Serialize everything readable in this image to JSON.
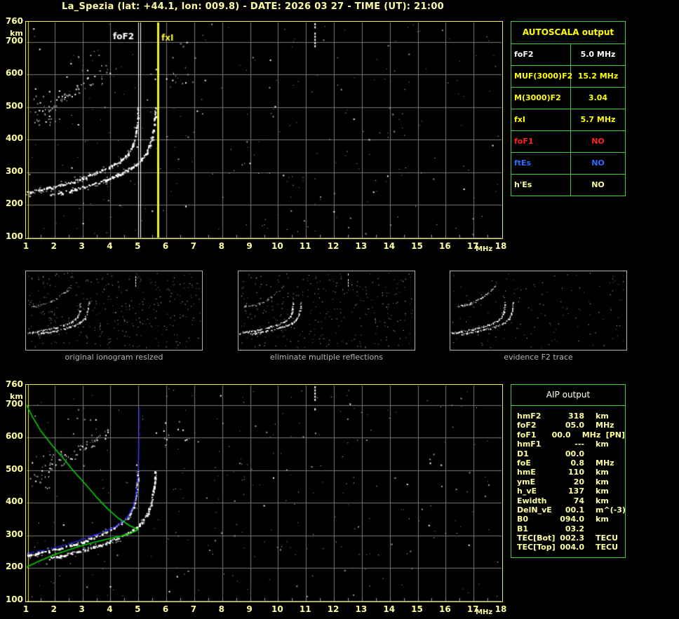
{
  "title": "La_Spezia (lat: +44.1, lon: 009.8) - DATE: 2026 03 27 - TIME (UT): 21:00",
  "colors": {
    "page_text": "#ffffa0",
    "plot_border": "#efef46",
    "grid": "#787878",
    "table_border": "#3dcd3d",
    "trace_white": "#ffffff",
    "noise_gray": "#9c9c9c",
    "profile_green": "#00d400",
    "model_blue": "#2a2aee",
    "fof2_marker": "#ffffff",
    "fxi_marker": "#f2f230",
    "caption_gray": "#b4b4b4"
  },
  "autoscala": {
    "header": "AUTOSCALA output",
    "rows": [
      {
        "param": "foF2",
        "value": "5.0 MHz",
        "color": "#ffffff"
      },
      {
        "param": "MUF(3000)F2",
        "value": "15.2 MHz",
        "color": "#ffff00"
      },
      {
        "param": "M(3000)F2",
        "value": "3.04",
        "color": "#ffff00"
      },
      {
        "param": "fxI",
        "value": "5.7 MHz",
        "color": "#ffff00"
      },
      {
        "param": "foF1",
        "value": "NO",
        "color": "#ff2020"
      },
      {
        "param": "ftEs",
        "value": "NO",
        "color": "#2e6bff"
      },
      {
        "param": "h'Es",
        "value": "NO",
        "color": "#ffffa0"
      }
    ]
  },
  "aip": {
    "header": "AIP output",
    "rows": [
      {
        "param": "hmF2",
        "value": "318",
        "unit": "km",
        "note": ""
      },
      {
        "param": "foF2",
        "value": "05.0",
        "unit": "MHz",
        "note": ""
      },
      {
        "param": "foF1",
        "value": "00.0",
        "unit": "MHz",
        "note": "[PN]"
      },
      {
        "param": "hmF1",
        "value": "---",
        "unit": "km",
        "note": ""
      },
      {
        "param": "D1",
        "value": "00.0",
        "unit": "",
        "note": ""
      },
      {
        "param": "foE",
        "value": "0.8",
        "unit": "MHz",
        "note": ""
      },
      {
        "param": "hmE",
        "value": "110",
        "unit": "km",
        "note": ""
      },
      {
        "param": "ymE",
        "value": "20",
        "unit": "km",
        "note": ""
      },
      {
        "param": "h_vE",
        "value": "137",
        "unit": "km",
        "note": ""
      },
      {
        "param": "Ewidth",
        "value": "74",
        "unit": "km",
        "note": ""
      },
      {
        "param": "DelN_vE",
        "value": "00.1",
        "unit": "m^(-3)",
        "note": ""
      },
      {
        "param": "B0",
        "value": "094.0",
        "unit": "km",
        "note": ""
      },
      {
        "param": "B1",
        "value": "03.2",
        "unit": "",
        "note": ""
      },
      {
        "param": "TEC[Bot]",
        "value": "002.3",
        "unit": "TECU",
        "note": ""
      },
      {
        "param": "TEC[Top]",
        "value": "004.0",
        "unit": "TECU",
        "note": ""
      }
    ]
  },
  "panels": [
    {
      "caption": "original ionogram resized"
    },
    {
      "caption": "eliminate multiple reflections"
    },
    {
      "caption": "evidence F2 trace"
    }
  ],
  "chart_data": [
    {
      "id": "main_ionogram",
      "type": "scatter",
      "title": "",
      "xlabel": "MHz",
      "ylabel": "km",
      "xlim": [
        1,
        18
      ],
      "ylim": [
        100,
        760
      ],
      "xticks": [
        1,
        2,
        3,
        4,
        5,
        6,
        7,
        8,
        9,
        10,
        11,
        12,
        13,
        14,
        15,
        16,
        17,
        18
      ],
      "yticks": [
        760,
        700,
        600,
        500,
        400,
        300,
        200,
        100
      ],
      "grid": true,
      "noise": {
        "count": 270
      },
      "clusters": [
        {
          "f": [
            1.1,
            2.3
          ],
          "h": [
            440,
            560
          ],
          "n": 26
        },
        {
          "f": [
            5.3,
            7.2
          ],
          "h": [
            560,
            660
          ],
          "n": 16
        },
        {
          "f": [
            2.3,
            4.2
          ],
          "h": [
            600,
            662
          ],
          "n": 10
        }
      ],
      "artifact_column": {
        "x": 11.3,
        "h": [
          690,
          758
        ]
      },
      "markers": [
        {
          "label": "foF2",
          "x": 5.0,
          "color": "#ffffff",
          "style": "double-line"
        },
        {
          "label": "fxI",
          "x": 5.7,
          "color": "#f2f230",
          "style": "thick-line"
        }
      ],
      "series": [
        {
          "name": "F2-ordinary-trace",
          "kind": "trace",
          "color": "#ffffff",
          "points": [
            [
              1.0,
              240
            ],
            [
              1.4,
              247
            ],
            [
              1.8,
              254
            ],
            [
              2.2,
              262
            ],
            [
              2.6,
              272
            ],
            [
              3.0,
              284
            ],
            [
              3.4,
              297
            ],
            [
              3.8,
              311
            ],
            [
              4.1,
              324
            ],
            [
              4.4,
              340
            ],
            [
              4.6,
              355
            ],
            [
              4.8,
              386
            ],
            [
              4.9,
              424
            ],
            [
              4.95,
              462
            ],
            [
              4.98,
              500
            ]
          ]
        },
        {
          "name": "F2-extraordinary-trace",
          "kind": "trace",
          "color": "#ffffff",
          "points": [
            [
              1.8,
              231
            ],
            [
              2.2,
              239
            ],
            [
              2.6,
              247
            ],
            [
              3.0,
              256
            ],
            [
              3.4,
              266
            ],
            [
              3.8,
              278
            ],
            [
              4.2,
              292
            ],
            [
              4.6,
              309
            ],
            [
              4.9,
              325
            ],
            [
              5.1,
              341
            ],
            [
              5.3,
              366
            ],
            [
              5.45,
              402
            ],
            [
              5.55,
              450
            ],
            [
              5.6,
              500
            ]
          ]
        },
        {
          "name": "second-hop-spread",
          "kind": "spread",
          "color": "#c8c8c8",
          "f": [
            1.35,
            3.9
          ],
          "h": [
            478,
            618
          ],
          "n": 52
        }
      ]
    },
    {
      "id": "profile_ionogram",
      "type": "scatter",
      "title": "",
      "xlabel": "MHz",
      "ylabel": "km",
      "xlim": [
        1,
        18
      ],
      "ylim": [
        100,
        760
      ],
      "xticks": [
        1,
        2,
        3,
        4,
        5,
        6,
        7,
        8,
        9,
        10,
        11,
        12,
        13,
        14,
        15,
        16,
        17,
        18
      ],
      "yticks": [
        760,
        700,
        600,
        500,
        400,
        300,
        200,
        100
      ],
      "grid": true,
      "noise": {
        "count": 270
      },
      "clusters": [
        {
          "f": [
            1.1,
            2.3
          ],
          "h": [
            440,
            560
          ],
          "n": 26
        },
        {
          "f": [
            5.3,
            7.2
          ],
          "h": [
            560,
            660
          ],
          "n": 14
        },
        {
          "f": [
            2.3,
            4.2
          ],
          "h": [
            600,
            662
          ],
          "n": 10
        }
      ],
      "artifact_column": {
        "x": 11.3,
        "h": [
          690,
          758
        ]
      },
      "markers": [],
      "series": [
        {
          "name": "F2-ordinary-trace",
          "kind": "trace",
          "color": "#ffffff",
          "points": [
            [
              1.0,
              240
            ],
            [
              1.4,
              247
            ],
            [
              1.8,
              254
            ],
            [
              2.2,
              262
            ],
            [
              2.6,
              272
            ],
            [
              3.0,
              284
            ],
            [
              3.4,
              297
            ],
            [
              3.8,
              311
            ],
            [
              4.1,
              324
            ],
            [
              4.4,
              340
            ],
            [
              4.6,
              355
            ],
            [
              4.8,
              386
            ],
            [
              4.9,
              424
            ],
            [
              4.95,
              462
            ],
            [
              4.98,
              500
            ]
          ]
        },
        {
          "name": "F2-extraordinary-trace",
          "kind": "trace",
          "color": "#ffffff",
          "points": [
            [
              1.8,
              231
            ],
            [
              2.2,
              239
            ],
            [
              2.6,
              247
            ],
            [
              3.0,
              256
            ],
            [
              3.4,
              266
            ],
            [
              3.8,
              278
            ],
            [
              4.2,
              292
            ],
            [
              4.6,
              309
            ],
            [
              4.9,
              325
            ],
            [
              5.1,
              341
            ],
            [
              5.3,
              366
            ],
            [
              5.45,
              402
            ],
            [
              5.55,
              450
            ],
            [
              5.6,
              500
            ]
          ]
        },
        {
          "name": "second-hop-spread",
          "kind": "spread",
          "color": "#c8c8c8",
          "f": [
            1.35,
            3.9
          ],
          "h": [
            478,
            618
          ],
          "n": 52
        },
        {
          "name": "electron-density-profile-topside",
          "kind": "profile",
          "color": "#00d400",
          "points": [
            [
              1.0,
              700
            ],
            [
              1.2,
              665
            ],
            [
              1.5,
              622
            ],
            [
              1.9,
              578
            ],
            [
              2.3,
              538
            ],
            [
              2.66,
              500
            ],
            [
              3.1,
              458
            ],
            [
              3.5,
              418
            ],
            [
              3.9,
              382
            ],
            [
              4.3,
              352
            ],
            [
              4.7,
              330
            ],
            [
              5.0,
              318
            ]
          ]
        },
        {
          "name": "electron-density-profile-bottomside",
          "kind": "profile",
          "color": "#00d400",
          "points": [
            [
              5.0,
              318
            ],
            [
              4.7,
              306
            ],
            [
              4.3,
              297
            ],
            [
              3.9,
              289
            ],
            [
              3.4,
              279
            ],
            [
              2.9,
              267
            ],
            [
              2.4,
              253
            ],
            [
              1.9,
              238
            ],
            [
              1.4,
              220
            ],
            [
              1.0,
              203
            ]
          ]
        },
        {
          "name": "reconstructed-o-trace",
          "kind": "bluetrace",
          "color": "#2a2aee",
          "points": [
            [
              1.0,
              247
            ],
            [
              1.5,
              256
            ],
            [
              2.0,
              265
            ],
            [
              2.5,
              277
            ],
            [
              3.0,
              291
            ],
            [
              3.5,
              306
            ],
            [
              4.0,
              323
            ],
            [
              4.3,
              338
            ],
            [
              4.6,
              361
            ],
            [
              4.8,
              393
            ],
            [
              4.9,
              430
            ],
            [
              4.95,
              470
            ],
            [
              4.98,
              540
            ],
            [
              5.0,
              610
            ],
            [
              5.0,
              692
            ]
          ]
        }
      ]
    },
    {
      "id": "processing_panels",
      "type": "scatter",
      "xlim": [
        1,
        14
      ],
      "ylim": [
        100,
        760
      ],
      "noise_counts": [
        340,
        300,
        135
      ],
      "arc": {
        "f": [
          1.35,
          4.3
        ],
        "h": [
          468,
          640
        ],
        "n": [
          46,
          40,
          62
        ]
      }
    }
  ]
}
